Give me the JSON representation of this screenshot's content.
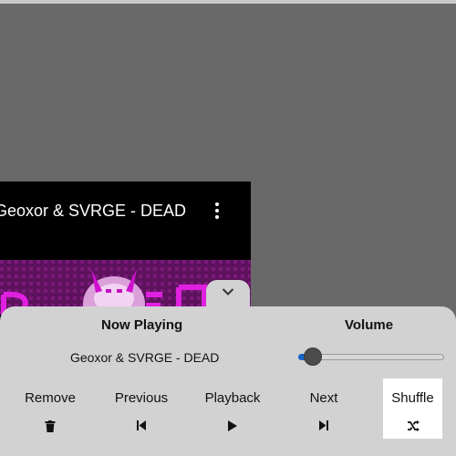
{
  "video": {
    "title": "Geoxor & SVRGE - DEAD",
    "menu_icon": "more-vert-icon"
  },
  "panel": {
    "collapse_icon": "chevron-down-icon",
    "now_playing_label": "Now Playing",
    "volume_label": "Volume",
    "current_track": "Geoxor & SVRGE - DEAD",
    "volume_level": 0.02
  },
  "controls": [
    {
      "label": "Remove",
      "icon": "trash-icon"
    },
    {
      "label": "Previous",
      "icon": "skip-previous-icon"
    },
    {
      "label": "Playback",
      "icon": "play-icon"
    },
    {
      "label": "Next",
      "icon": "skip-next-icon"
    },
    {
      "label": "Shuffle",
      "icon": "shuffle-icon"
    }
  ],
  "colors": {
    "backdrop": "#696969",
    "panel": "#d2d2d2",
    "accent": "#1a66c8",
    "shuffle_highlight": "#ffffff"
  }
}
